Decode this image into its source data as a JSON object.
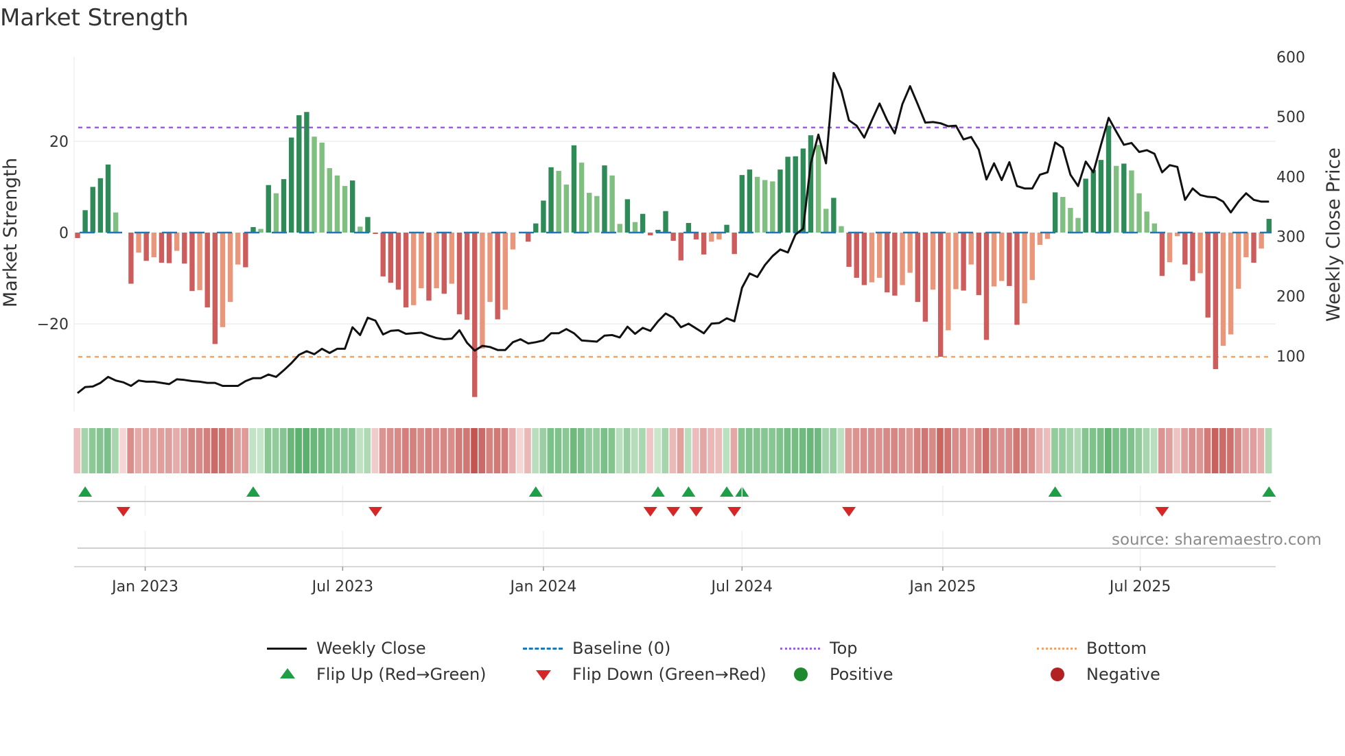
{
  "title": "Market Strength",
  "source": "source: sharemaestro.com",
  "legend": {
    "weekly_close": "Weekly Close",
    "baseline": "Baseline (0)",
    "top": "Top",
    "bottom": "Bottom",
    "flip_up": "Flip Up (Red→Green)",
    "flip_down": "Flip Down (Green→Red)",
    "positive": "Positive",
    "negative": "Negative"
  },
  "colors": {
    "close": "#111111",
    "baseline": "#1f77b4",
    "top": "#9b5de5",
    "bottom": "#f4a261",
    "pos_rising": "#2e8b57",
    "pos_falling": "#7fbf7f",
    "neg_falling": "#cd5c5c",
    "neg_rising": "#e9967a",
    "flip_up": "#1e9e46",
    "flip_down": "#d62728",
    "positive": "#1e8a2e",
    "negative": "#b22222"
  },
  "chart_data": {
    "type": "bar",
    "title": "Market Strength",
    "xlabel": "",
    "ylabel": "Market Strength",
    "y2label": "Weekly Close Price",
    "frequency": "weekly",
    "start_date": "2022-10-31",
    "ylim": [
      -39.2,
      38.6
    ],
    "y2lim": [
      7,
      601
    ],
    "yticks": [
      {
        "v": 20,
        "label": "20"
      },
      {
        "v": 0,
        "label": "0"
      },
      {
        "v": -20,
        "label": "−20"
      }
    ],
    "y2ticks": [
      {
        "v": 100,
        "label": "100"
      },
      {
        "v": 200,
        "label": "200"
      },
      {
        "v": 300,
        "label": "300"
      },
      {
        "v": 400,
        "label": "400"
      },
      {
        "v": 500,
        "label": "500"
      },
      {
        "v": 600,
        "label": "600"
      }
    ],
    "xticks": [
      {
        "date": "2023-01-01",
        "label": "Jan 2023"
      },
      {
        "date": "2023-07-01",
        "label": "Jul 2023"
      },
      {
        "date": "2024-01-01",
        "label": "Jan 2024"
      },
      {
        "date": "2024-07-01",
        "label": "Jul 2024"
      },
      {
        "date": "2025-01-01",
        "label": "Jan 2025"
      },
      {
        "date": "2025-07-01",
        "label": "Jul 2025"
      }
    ],
    "top_level": 23,
    "bottom_level": -27.2,
    "baseline": 0,
    "strength": [
      -1.2,
      4.9,
      10,
      11.9,
      14.9,
      4.4,
      0,
      -11.2,
      -4.4,
      -6.2,
      -5.4,
      -6.6,
      -6.7,
      -4,
      -6.8,
      -12.8,
      -12.6,
      -16.4,
      -24.4,
      -20.7,
      -15.2,
      -7,
      -7.6,
      1.2,
      0.8,
      10.4,
      8.6,
      11.7,
      20.8,
      25.7,
      26.4,
      21,
      19.7,
      14.1,
      12.5,
      10.2,
      11.4,
      1.3,
      3.4,
      -0.3,
      -9.6,
      -11,
      -12.5,
      -16.4,
      -15.9,
      -12.2,
      -14.9,
      -12.2,
      -13.4,
      -11.2,
      -17.9,
      -19.1,
      -36,
      -25.4,
      -15.2,
      -19,
      -16.9,
      -3.7,
      0,
      -2,
      2,
      7,
      14.3,
      13.5,
      10.5,
      19.1,
      15.3,
      8.7,
      8,
      14.7,
      12.5,
      1.9,
      7.3,
      2.3,
      4.1,
      -0.6,
      0.6,
      4.7,
      -1.8,
      -6.1,
      2.1,
      -1.5,
      -4.8,
      -2,
      -1.5,
      1.7,
      -4.7,
      12.6,
      13.8,
      12.2,
      11.5,
      11.2,
      13.8,
      16.6,
      16.7,
      18.4,
      21.3,
      19.2,
      5.2,
      7.6,
      1.4,
      -7.5,
      -9.9,
      -11.5,
      -10.9,
      -9.9,
      -13.1,
      -13.8,
      -11.5,
      -8.8,
      -15.2,
      -19.5,
      -12.5,
      -27.2,
      -21.4,
      -12.4,
      -12.7,
      -7,
      -13.7,
      -23.5,
      -11.8,
      -10.6,
      -11.7,
      -20.2,
      -15.5,
      -10.4,
      -2.7,
      -1.4,
      8.8,
      7.8,
      5.4,
      3.2,
      11.8,
      13.7,
      15.9,
      23.4,
      14.6,
      15.1,
      13.6,
      8.6,
      4.6,
      2,
      -9.5,
      -6.5,
      -0.8,
      -7,
      -10.6,
      -8.9,
      -18.6,
      -29.9,
      -24.8,
      -22.3,
      -12.3,
      -5.4,
      -6.6,
      -3.5,
      3
    ],
    "close": [
      38,
      48,
      49,
      55,
      65,
      59,
      56,
      50,
      59,
      57,
      57,
      55,
      53,
      61,
      60,
      58,
      57,
      55,
      55,
      50,
      50,
      50,
      58,
      63,
      63,
      69,
      65,
      76,
      88,
      102,
      108,
      103,
      112,
      105,
      112,
      112,
      148,
      135,
      164,
      159,
      136,
      142,
      143,
      137,
      138,
      139,
      134,
      130,
      128,
      129,
      143,
      122,
      109,
      117,
      115,
      110,
      110,
      123,
      128,
      121,
      123,
      126,
      138,
      138,
      145,
      138,
      126,
      125,
      124,
      134,
      135,
      131,
      149,
      137,
      147,
      142,
      158,
      171,
      164,
      148,
      154,
      146,
      138,
      154,
      155,
      163,
      158,
      214,
      238,
      232,
      252,
      267,
      278,
      273,
      303,
      313,
      422,
      470,
      422,
      573,
      544,
      494,
      485,
      465,
      494,
      522,
      494,
      472,
      521,
      551,
      521,
      490,
      491,
      489,
      484,
      485,
      462,
      466,
      445,
      395,
      422,
      394,
      424,
      384,
      380,
      380,
      403,
      407,
      457,
      448,
      403,
      384,
      425,
      407,
      453,
      498,
      475,
      453,
      456,
      441,
      444,
      438,
      407,
      419,
      416,
      361,
      380,
      369,
      366,
      365,
      358,
      340,
      358,
      372,
      361,
      358,
      358
    ]
  }
}
